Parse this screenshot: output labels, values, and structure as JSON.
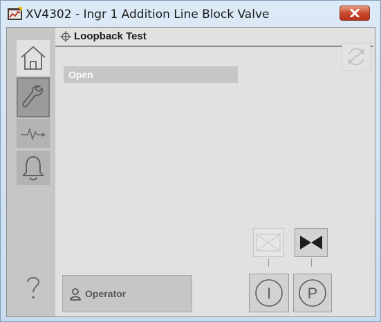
{
  "window": {
    "title": "XV4302 - Ingr 1 Addition Line Block Valve"
  },
  "tab": {
    "title": "Loopback Test"
  },
  "status": {
    "text": "Open"
  },
  "sidebar": {
    "items": [
      {
        "name": "home",
        "icon": "home-icon"
      },
      {
        "name": "maintenance",
        "icon": "wrench-icon",
        "selected": true
      },
      {
        "name": "trends",
        "icon": "trend-icon"
      },
      {
        "name": "alarms",
        "icon": "bell-icon"
      },
      {
        "name": "help",
        "icon": "question-icon"
      }
    ]
  },
  "buttons": {
    "operator_label": "Operator",
    "mode_interlock": "I",
    "mode_permissive": "P"
  },
  "colors": {
    "sidebar": "#c6c6c6",
    "client": "#e1e1e1",
    "close_button": "#c6452a"
  }
}
